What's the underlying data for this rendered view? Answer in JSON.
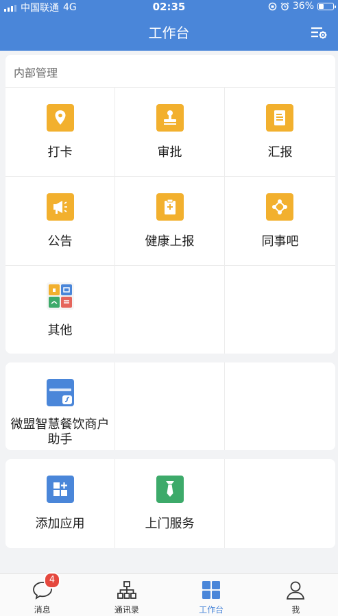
{
  "status_bar": {
    "carrier": "中国联通",
    "network": "4G",
    "time": "02:35",
    "battery": "36%",
    "battery_level": 0.36
  },
  "header": {
    "title": "工作台",
    "settings_icon": "settings-list-icon"
  },
  "internal": {
    "title": "内部管理",
    "items": [
      {
        "label": "打卡",
        "icon": "location-pin-icon",
        "color": "#f2b02e"
      },
      {
        "label": "审批",
        "icon": "stamp-icon",
        "color": "#f2b02e"
      },
      {
        "label": "汇报",
        "icon": "report-document-icon",
        "color": "#f2b02e"
      },
      {
        "label": "公告",
        "icon": "megaphone-icon",
        "color": "#f2b02e"
      },
      {
        "label": "健康上报",
        "icon": "health-clipboard-icon",
        "color": "#f2b02e"
      },
      {
        "label": "同事吧",
        "icon": "share-nodes-icon",
        "color": "#f2b02e"
      },
      {
        "label": "其他",
        "icon": "app-grid-icon",
        "color": "#ffffff"
      }
    ]
  },
  "mini_app": {
    "label": "微盟智慧餐饮商户助手",
    "icon": "mini-program-icon",
    "color": "#4a86d9"
  },
  "tools": {
    "items": [
      {
        "label": "添加应用",
        "icon": "add-app-icon",
        "color": "#4a86d9"
      },
      {
        "label": "上门服务",
        "icon": "necktie-icon",
        "color": "#3daa6a"
      }
    ]
  },
  "tabbar": {
    "items": [
      {
        "label": "消息",
        "icon": "chat-bubble-icon",
        "badge": "4"
      },
      {
        "label": "通讯录",
        "icon": "org-chart-icon"
      },
      {
        "label": "工作台",
        "icon": "workbench-grid-icon",
        "active": true
      },
      {
        "label": "我",
        "icon": "user-icon"
      }
    ]
  }
}
